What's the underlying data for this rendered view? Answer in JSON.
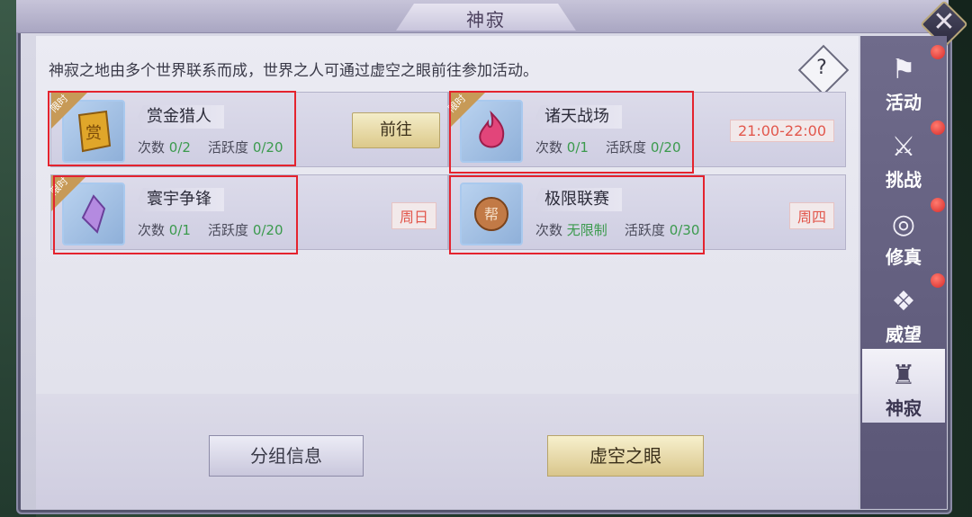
{
  "window": {
    "title": "神寂",
    "close_icon": "close-icon"
  },
  "description": "神寂之地由多个世界联系而成，世界之人可通过虚空之眼前往参加活动。",
  "help_label": "?",
  "cards": [
    {
      "badge": "限时",
      "title": "赏金猎人",
      "count_label": "次数",
      "count_value": "0/2",
      "activity_label": "活跃度",
      "activity_value": "0/20",
      "action": "前往"
    },
    {
      "badge": "限时",
      "title": "诸天战场",
      "count_label": "次数",
      "count_value": "0/1",
      "activity_label": "活跃度",
      "activity_value": "0/20",
      "time": "21:00-22:00"
    },
    {
      "badge": "限时",
      "title": "寰宇争锋",
      "count_label": "次数",
      "count_value": "0/1",
      "activity_label": "活跃度",
      "activity_value": "0/20",
      "day": "周日"
    },
    {
      "title": "极限联赛",
      "count_label": "次数",
      "count_value": "无限制",
      "activity_label": "活跃度",
      "activity_value": "0/30",
      "day": "周四",
      "icon_text": "帮"
    }
  ],
  "buttons": {
    "group_info": "分组信息",
    "void_eye": "虚空之眼"
  },
  "sidebar": [
    {
      "label": "活动",
      "icon": "banner-icon",
      "alert": true
    },
    {
      "label": "挑战",
      "icon": "swords-icon",
      "alert": true
    },
    {
      "label": "修真",
      "icon": "swirl-icon",
      "alert": true
    },
    {
      "label": "威望",
      "icon": "wings-icon",
      "alert": true
    },
    {
      "label": "神寂",
      "icon": "spire-icon",
      "alert": false,
      "active": true
    }
  ],
  "colors": {
    "accent_gold": "#dcc98a",
    "highlight_red": "#e4232e",
    "progress_green": "#3b9a4d",
    "time_red": "#e2574c"
  }
}
